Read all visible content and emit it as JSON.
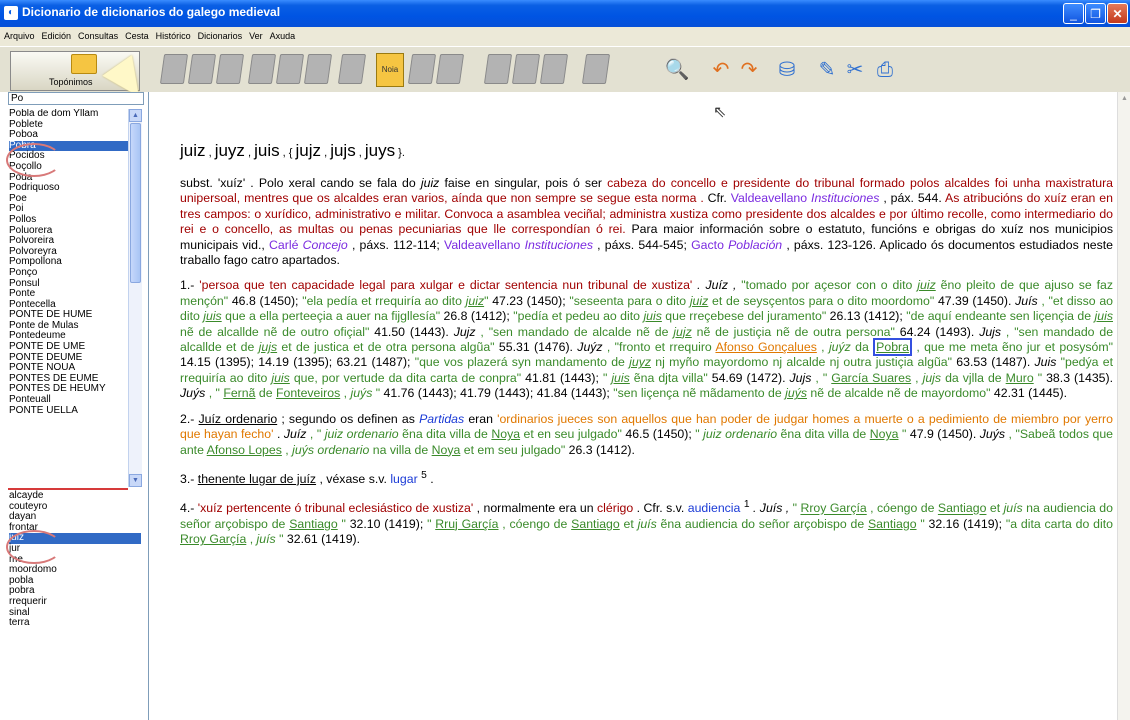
{
  "window": {
    "title": "Dicionario de dicionarios do galego medieval"
  },
  "menu": [
    "Arquivo",
    "Edición",
    "Consultas",
    "Cesta",
    "Histórico",
    "Dicionarios",
    "Ver",
    "Axuda"
  ],
  "toolbar": {
    "toponimos_label": "Topónimos",
    "noia_label": "Noia"
  },
  "search": {
    "value": "Po"
  },
  "toponym_list": [
    "Pobla de dom Yllam",
    "Poblete",
    "Poboa",
    "Pobra",
    "Pocidos",
    "Poçollo",
    "Poda",
    "Podriquoso",
    "Poe",
    "Poi",
    "Pollos",
    "Poluorera",
    "Polvoreira",
    "Polvoreyra",
    "Pompollona",
    "Ponço",
    "Ponsul",
    "Ponte",
    "Pontecella",
    "PONTE DE HUME",
    "Ponte de Mulas",
    "Pontedeume",
    "PONTE DE UME",
    "PONTE DEUME",
    "PONTE NOUA",
    "PONTES DE EUME",
    "PONTES DE HEUMY",
    "Ponteuall",
    "PONTE UELLA"
  ],
  "toponym_selected": "Pobra",
  "word_list": [
    "alcayde",
    "couteyro",
    "dayan",
    "frontar",
    "juiz",
    "jur",
    "me",
    "moordomo",
    "pobla",
    "pobra",
    "rrequerir",
    "sinal",
    "terra"
  ],
  "word_selected": "juiz",
  "entry": {
    "headword_parts": [
      "juiz",
      " , ",
      "juyz",
      " , ",
      "juis",
      " , { ",
      "jujz",
      " , ",
      "jujs",
      " , ",
      "juys",
      " }."
    ],
    "def_lead": "subst. 'xuíz' . Polo xeral cando se fala do ",
    "def_juiz": "juiz",
    "def_rest1": " faise en singular, pois ó ser ",
    "def_red1": "cabeza do concello e presidente do tribunal formado polos alcaldes foi unha maxistratura unipersoal, mentres que os alcaldes eran varios, aínda que non sempre se segue esta norma .",
    "def_cfr": " Cfr. ",
    "valdeavellano": "Valdeavellano",
    "instituciones": "Instituciones",
    "def_pax1": " , páx. 544. ",
    "def_red2": "As atribucións do xuíz eran en tres campos: o xurídico, administrativo e militar. Convoca a asamblea veciñal; administra xustiza como presidente dos alcaldes e por último recolle, como intermediario do rei e o concello, as multas ou penas pecuniarias que lle correspondían ó rei.",
    "def_maior": " Para maior información sobre o estatuto, funcións e obrigas do xuíz nos municipios municipais vid., ",
    "carle": "Carlé",
    "concejo": "Concejo",
    "def_pax2": " , páxs. 112-114; ",
    "def_pax3": " , páxs. 544-545; ",
    "gacto": "Gacto",
    "poblacion": "Población",
    "def_end": " , páxs. 123-126. Aplicado ós documentos estudiados neste traballo fago catro apartados.",
    "s1_num": "1.- ",
    "s1_def": "'persoa que ten capacidade legal para xulgar e dictar sentencia nun tribunal de xustiza'",
    "s1_juiz": " . Juíz , ",
    "s2_num": "2.- ",
    "s2_term": "Juíz ordenario",
    "s2_mid": " ; segundo os definen as ",
    "partidas": "Partidas",
    "s2_eran": " eran ",
    "s2_def": "'ordinarios jueces son aquellos que han poder de judgar homes a muerte o a pedimiento de miembro por yerro que hayan fecho'",
    "s3_num": "3.- ",
    "s3_term": "thenente lugar de juíz",
    "s3_rest": " , véxase s.v. ",
    "lugar": "lugar",
    "lugar_sup": "5",
    "s3_end": " .",
    "s4_num": "4.- ",
    "s4_def": "'xuíz pertencente ó tribunal eclesiástico de xustiza'",
    "s4_mid": " , normalmente era un ",
    "clerigo": "clérigo",
    "s4_cfr": " . Cfr. s.v. ",
    "audiencia": "audiencia",
    "aud_sup": "1",
    "s4_juis": " . Juís , "
  },
  "cites": {
    "c1a": "\"tomado por açesor con o dito ",
    "c1b": "juiz",
    "c1c": " ẽno pleito de que ajuso se faz mençón\"",
    "r1": " 46.8 (1450); ",
    "c2a": "\"ela pedía et rrequiría ao dito ",
    "c2b": "juiz",
    "c2c": "\"",
    "r2": " 47.23 (1450); ",
    "c3a": "\"seseenta para o dito ",
    "c3b": "juiz",
    "c3c": " et de seysçentos para o dito moordomo\"",
    "r3": " 47.39 (1450). ",
    "juis": "Juís",
    "c4a": " , \"et disso ao dito ",
    "c4b": "juis",
    "c4c": " que a ella perteeçia a auer na fijgllesía\"",
    "r4": " 26.8 (1412); ",
    "c5a": "\"pedía et pedeu ao dito ",
    "c5b": "juis",
    "c5c": " que rreçebese del juramento\"",
    "r5": " 26.13 (1412); ",
    "c6a": "\"de aquí endeante sen liçençia de ",
    "c6b": "juis",
    "c6c": " nẽ de alcallde nẽ de outro ofiçial\"",
    "r6": " 41.50 (1443). ",
    "jujz": "Jujz",
    "c7a": " , \"sen mandado de alcalde nẽ de ",
    "c7b": "jujz",
    "c7c": " nẽ de justiçia nẽ de outra persona\"",
    "r7": " 64.24 (1493). ",
    "jujs": "Jujs",
    "c8a": " , \"sen mandado de alcallde et de ",
    "c8b": "jujs",
    "c8c": " et de justica et de otra persona algũa\"",
    "r8": " 55.31 (1476). ",
    "juyz": "Juýz",
    "c9a": " , \"fronto et rrequiro ",
    "afonso": "Afonso Gonçalues",
    "c9b": " , ",
    "c9c": "juýz",
    "c9d": " da ",
    "pobra": "Pobra",
    "c9e": " , que me meta ẽno jur et posysóm\"",
    "r9": " 14.15 (1395); 14.19 (1395); 63.21 (1487); ",
    "c10a": "\"que vos plazerá syn mandamento de ",
    "c10b": "juyz",
    "c10c": " nj myño mayordomo nj alcalde nj outra justiçia algũa\"",
    "r10": " 63.53 (1487). ",
    "juis2": "Juis",
    "c11a": " \"pedýa et rrequiría ao dito ",
    "c11b": "juis",
    "c11c": " que, por vertude da dita carta de conpra\"",
    "r11": " 41.81 (1443); ",
    "c12a": "\" ",
    "c12b": "juis",
    "c12c": " ẽna djta villa\"",
    "r12": " 54.69 (1472). ",
    "juys": "Jujs",
    "c13a": " , \" ",
    "garcia": "García Suares",
    "c13b": " , ",
    "c13c": "jujs",
    "c13d": " da vjlla de ",
    "muro": "Muro",
    "c13e": " \"",
    "r13": " 38.3 (1435). ",
    "juys2": "Juýs",
    "c14a": " , \" ",
    "ferna": "Fernã",
    "c14b": " de ",
    "fonteveiros": "Fonteveiros",
    "c14c": " , ",
    "c14d": "juýs",
    "c14e": " \"",
    "r14": " 41.76 (1443); 41.79 (1443); 41.84 (1443); ",
    "c15a": "\"sen liçença nẽ mãdamento de ",
    "c15b": "juýs",
    "c15c": " nẽ de alcalde nẽ de mayordomo\"",
    "r15": " 42.31 (1445).",
    "s2juiz": "Juíz",
    "s2c1a": " , \" ",
    "s2c1b": "juiz ordenario",
    "s2c1c": " ẽna dita villa de ",
    "noya": "Noya",
    "s2c1d": " et en seu julgado\"",
    "s2r1": " 46.5 (1450); ",
    "s2c2a": "\" ",
    "s2c2b": "juiz ordenario",
    "s2c2c": " ẽna dita villa de ",
    "s2c2d": " \"",
    "s2r2": " 47.9 (1450). ",
    "s2juys": "Juýs",
    "s2c3a": " , \"Sabeã todos que ante ",
    "afonsolopes": "Afonso Lopes",
    "s2c3b": " , ",
    "s2c3c": "juýs ordenario",
    "s2c3d": " na villa de ",
    "s2c3e": " et em seu julgado\"",
    "s2r3": " 26.3 (1412).",
    "s4c1a": "\" ",
    "rroy": "Rroy Garçía",
    "s4c1b": " , cóengo de ",
    "santiago": "Santiago",
    "s4c1c": " et ",
    "s4c1d": "juís",
    "s4c1e": " na audiencia do señor arçobispo de ",
    "s4c1f": " \"",
    "s4r1": " 32.10 (1419); ",
    "s4c2a": "\" ",
    "rruj": "Rruj Garçía",
    "s4c2b": " , cóengo de ",
    "s4c2c": " et ",
    "s4c2d": "juís",
    "s4c2e": " ẽna audiencia do señor arçobispo de ",
    "s4c2f": " \"",
    "s4r2": " 32.16 (1419); ",
    "s4c3a": "\"a dita carta do dito ",
    "s4c3b": " , ",
    "s4c3c": "juís",
    "s4c3d": " \"",
    "s4r3": " 32.61 (1419)."
  }
}
